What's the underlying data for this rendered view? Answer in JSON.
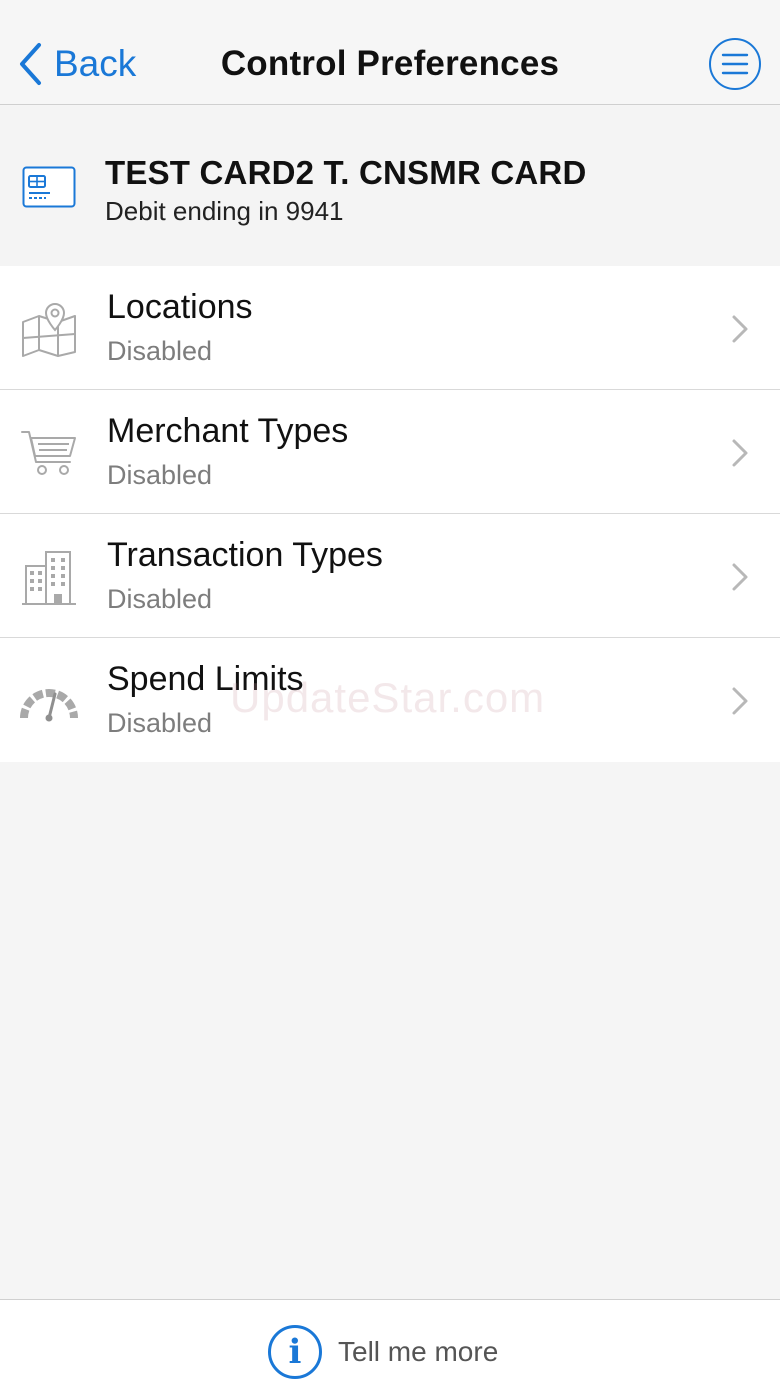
{
  "nav": {
    "back_label": "Back",
    "title": "Control Preferences",
    "menu_icon": "hamburger-menu-icon"
  },
  "card": {
    "name": "TEST CARD2 T. CNSMR CARD",
    "subtitle": "Debit ending in 9941",
    "icon": "credit-card-icon"
  },
  "controls": [
    {
      "title": "Locations",
      "status": "Disabled",
      "icon": "map-pin-icon"
    },
    {
      "title": "Merchant Types",
      "status": "Disabled",
      "icon": "shopping-cart-icon"
    },
    {
      "title": "Transaction Types",
      "status": "Disabled",
      "icon": "buildings-icon"
    },
    {
      "title": "Spend Limits",
      "status": "Disabled",
      "icon": "speedometer-icon"
    }
  ],
  "watermark": "UpdateStar.com",
  "footer": {
    "tell_more_label": "Tell me more",
    "info_icon_glyph": "i"
  },
  "colors": {
    "accent": "#1a78d7",
    "background": "#f5f5f5",
    "secondary_text": "#7d7d7d"
  }
}
